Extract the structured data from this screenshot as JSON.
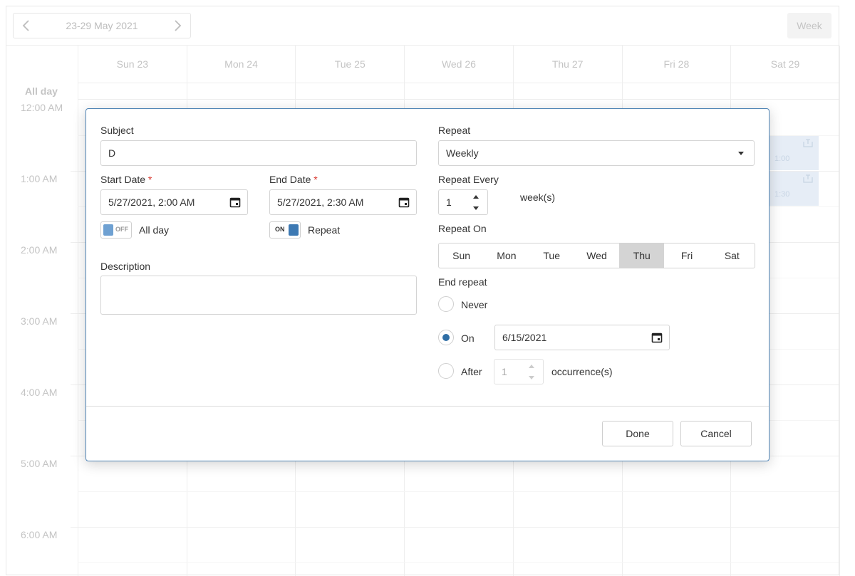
{
  "scheduler": {
    "date_range": "23-29 May 2021",
    "view_button": "Week",
    "days": [
      "Sun 23",
      "Mon 24",
      "Tue 25",
      "Wed 26",
      "Thu 27",
      "Fri 28",
      "Sat 29"
    ],
    "all_day_label": "All day",
    "times": [
      "12:00 AM",
      "1:00 AM",
      "2:00 AM",
      "3:00 AM",
      "4:00 AM",
      "5:00 AM",
      "6:00 AM"
    ],
    "appointments": [
      {
        "time": "1:00"
      },
      {
        "time": "1:30"
      }
    ]
  },
  "dialog": {
    "subject_label": "Subject",
    "subject_value": "D",
    "start_label": "Start Date",
    "start_value": "5/27/2021, 2:00 AM",
    "end_label": "End Date",
    "end_value": "5/27/2021, 2:30 AM",
    "required_mark": "*",
    "allday_toggle": "OFF",
    "allday_label": "All day",
    "repeat_toggle": "ON",
    "repeat_toggle_label": "Repeat",
    "description_label": "Description",
    "repeat_label": "Repeat",
    "repeat_value": "Weekly",
    "repeat_every_label": "Repeat Every",
    "repeat_every_value": "1",
    "repeat_every_unit": "week(s)",
    "repeat_on_label": "Repeat On",
    "weekdays": [
      "Sun",
      "Mon",
      "Tue",
      "Wed",
      "Thu",
      "Fri",
      "Sat"
    ],
    "selected_weekday": "Thu",
    "end_repeat_label": "End repeat",
    "end_never": "Never",
    "end_on": "On",
    "end_on_date": "6/15/2021",
    "end_after": "After",
    "end_after_value": "1",
    "end_after_unit": "occurrence(s)",
    "selected_end": "On",
    "done_label": "Done",
    "cancel_label": "Cancel"
  },
  "colors": {
    "accent": "#2f6ea5",
    "dialog_border": "#4f84b5",
    "selected_day": "#d4d4d4",
    "appointment": "#e6edf6"
  }
}
